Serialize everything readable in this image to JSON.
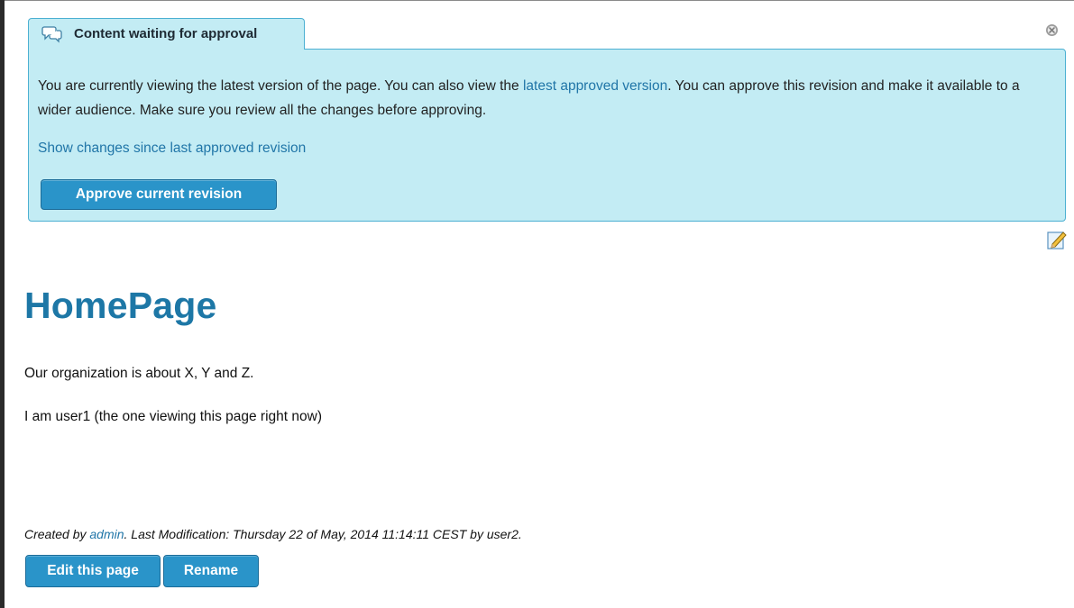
{
  "approval": {
    "tab_title": "Content waiting for approval",
    "text_before_link": "You are currently viewing the latest version of the page. You can also view the ",
    "latest_link": "latest approved version",
    "text_after_link": ". You can approve this revision and make it available to a wider audience. Make sure you review all the changes before approving.",
    "show_changes": "Show changes since last approved revision",
    "approve_button": "Approve current revision",
    "tab_icon": "speech-bubbles-icon",
    "close_icon": "close-icon"
  },
  "page": {
    "edit_icon": "edit-pencil-icon",
    "title": "HomePage",
    "paragraphs": [
      "Our organization is about X, Y and Z.",
      "I am user1 (the one viewing this page right now)"
    ]
  },
  "footer": {
    "created_by_prefix": "Created by ",
    "created_by_user": "admin",
    "modification": ". Last Modification: Thursday 22 of May, 2014 11:14:11 CEST by user2.",
    "edit_button": "Edit this page",
    "rename_button": "Rename"
  },
  "colors": {
    "panel_bg": "#c3ecf4",
    "panel_border": "#4cb0d2",
    "button": "#2a94c9",
    "link": "#2176a8",
    "title": "#1d77a6"
  }
}
